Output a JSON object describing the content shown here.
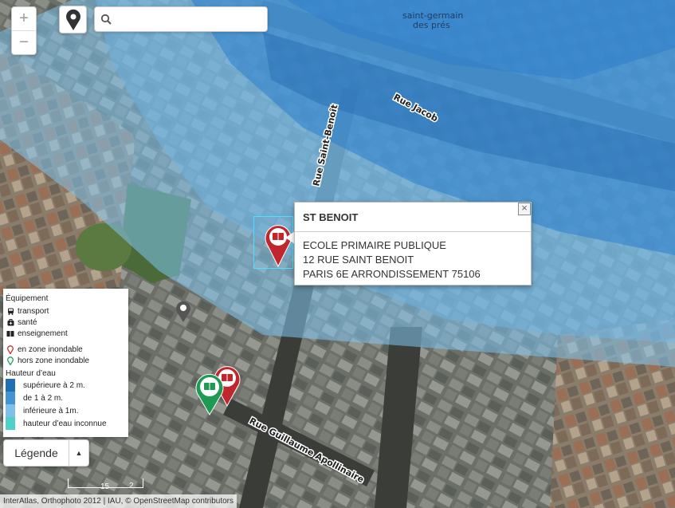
{
  "map": {
    "streets": [
      "Rue Jacob",
      "Rue Saint-Benoît",
      "Rue Guillaume Apollinaire"
    ],
    "area_label_line1": "saint-germain",
    "area_label_line2": "des prés"
  },
  "zoom": {
    "in_label": "+",
    "out_label": "−"
  },
  "search": {
    "value": "",
    "placeholder": "",
    "icon": "search-icon"
  },
  "locate": {
    "icon": "map-pin-icon"
  },
  "popup": {
    "title": "ST BENOIT",
    "close_label": "×",
    "lines": [
      "ECOLE PRIMAIRE PUBLIQUE",
      "12 RUE SAINT BENOIT",
      "PARIS 6E ARRONDISSEMENT 75106"
    ]
  },
  "legend": {
    "equipment_title": "Équipement",
    "equipment": [
      {
        "icon": "bus-icon",
        "label": "transport"
      },
      {
        "icon": "medical-bag-icon",
        "label": "santé"
      },
      {
        "icon": "book-icon",
        "label": "enseignement"
      }
    ],
    "zones": [
      {
        "icon": "red-pin-icon",
        "color": "#c0392b",
        "label": "en zone inondable"
      },
      {
        "icon": "green-pin-icon",
        "color": "#27a35a",
        "label": "hors zone inondable"
      }
    ],
    "water_title": "Hauteur d’eau",
    "water_levels": [
      {
        "color": "#1f6fb5",
        "label": "supérieure à 2 m."
      },
      {
        "color": "#4494d2",
        "label": "de 1 à 2 m."
      },
      {
        "color": "#7ec0ea",
        "label": "inférieure à 1m."
      },
      {
        "color": "#4fd1c9",
        "label": "hauteur d’eau inconnue"
      }
    ],
    "toggle_label": "Légende",
    "toggle_caret": "▲"
  },
  "scale": {
    "label1": "15",
    "label2": "2"
  },
  "attribution": "InterAtlas, Orthophoto 2012 | IAU, © OpenStreetMap contributors"
}
